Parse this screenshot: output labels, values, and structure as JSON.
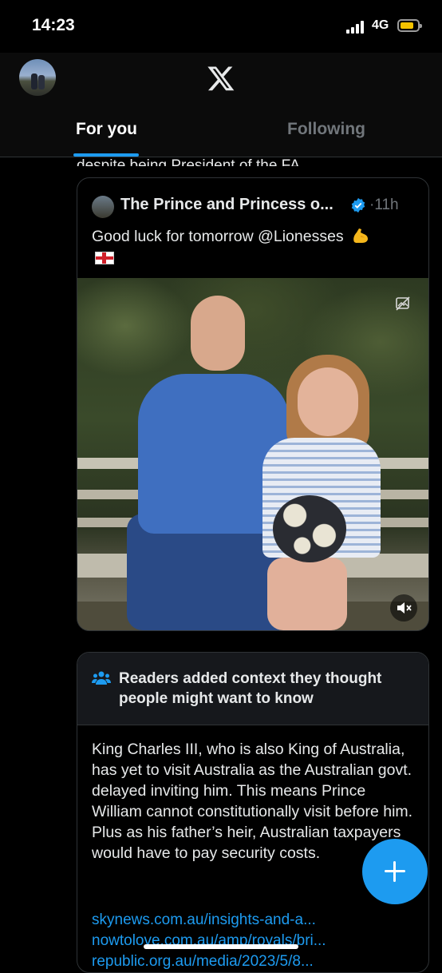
{
  "status_bar": {
    "time": "14:23",
    "network": "4G"
  },
  "header": {
    "tabs": [
      {
        "label": "For you",
        "active": true
      },
      {
        "label": "Following",
        "active": false
      }
    ]
  },
  "timeline": {
    "partial_text": "despite being President of the FA."
  },
  "quoted_post": {
    "author": "The Prince and Princess o...",
    "separator": "·",
    "time": "11h",
    "text": "Good luck for tomorrow @Lionesses"
  },
  "community_note": {
    "title": "Readers added context they thought people might want to know",
    "body": "King Charles III, who is also King of Australia, has yet to visit Australia as the Australian govt. delayed inviting him. This means Prince William cannot constitutionally visit before him. Plus as his father’s heir, Australian taxpayers would have to pay security costs.",
    "links": [
      "skynews.com.au/insights-and-a...",
      "nowtolove.com.au/amp/royals/bri...",
      "republic.org.au/media/2023/5/8..."
    ]
  },
  "colors": {
    "accent": "#1d9bf0",
    "background": "#000000",
    "text": "#e7e9ea",
    "muted": "#71767b"
  }
}
